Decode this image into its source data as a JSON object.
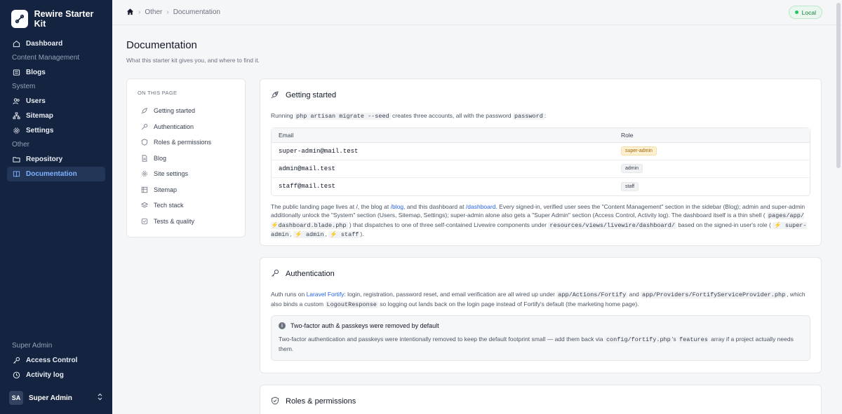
{
  "app": {
    "name": "Rewire Starter Kit"
  },
  "sidebar": {
    "items": [
      {
        "type": "item",
        "label": "Dashboard",
        "icon": "home-icon",
        "active": false
      },
      {
        "type": "section",
        "label": "Content Management"
      },
      {
        "type": "item",
        "label": "Blogs",
        "icon": "list-icon",
        "active": false
      },
      {
        "type": "section",
        "label": "System"
      },
      {
        "type": "item",
        "label": "Users",
        "icon": "users-icon",
        "active": false
      },
      {
        "type": "item",
        "label": "Sitemap",
        "icon": "sitemap-icon",
        "active": false
      },
      {
        "type": "item",
        "label": "Settings",
        "icon": "gear-icon",
        "active": false
      },
      {
        "type": "section",
        "label": "Other"
      },
      {
        "type": "item",
        "label": "Repository",
        "icon": "folder-icon",
        "active": false
      },
      {
        "type": "item",
        "label": "Documentation",
        "icon": "book-icon",
        "active": true
      }
    ],
    "bottom": [
      {
        "type": "section",
        "label": "Super Admin"
      },
      {
        "type": "item",
        "label": "Access Control",
        "icon": "key-icon"
      },
      {
        "type": "item",
        "label": "Activity log",
        "icon": "clock-icon"
      }
    ],
    "user": {
      "initials": "SA",
      "name": "Super Admin"
    }
  },
  "breadcrumb": {
    "items": [
      "Other",
      "Documentation"
    ]
  },
  "env_badge": "Local",
  "page": {
    "title": "Documentation",
    "subtitle": "What this starter kit gives you, and where to find it."
  },
  "toc": {
    "title": "ON THIS PAGE",
    "items": [
      "Getting started",
      "Authentication",
      "Roles & permissions",
      "Blog",
      "Site settings",
      "Sitemap",
      "Tech stack",
      "Tests & quality"
    ]
  },
  "getting_started": {
    "title": "Getting started",
    "intro_1": "Running",
    "intro_code": "php artisan migrate --seed",
    "intro_2": "creates three accounts, all with the password",
    "intro_password": "password",
    "intro_3": ":",
    "table": {
      "headers": [
        "Email",
        "Role"
      ],
      "rows": [
        {
          "email": "super-admin@mail.test",
          "role": "super-admin"
        },
        {
          "email": "admin@mail.test",
          "role": "admin"
        },
        {
          "email": "staff@mail.test",
          "role": "staff"
        }
      ]
    },
    "p1": "The public landing page lives at /, the blog at",
    "link_blog": "/blog",
    "p2": ", and this dashboard at",
    "link_dashboard": "/dashboard",
    "p3": ". Every signed-in, verified user sees the \"Content Management\" section in the sidebar (Blog); admin and super-admin additionally unlock the \"System\" section (Users, Sitemap, Settings); super-admin alone also gets a \"Super Admin\" section (Access Control, Activity log). The dashboard itself is a thin shell (",
    "code_pages_pre": "pages/app/",
    "code_pages_post": "dashboard.blade.php",
    "p4": ") that dispatches to one of three self-contained Livewire components under",
    "code_views": "resources/views/livewire/dashboard/",
    "p5": "based on the signed-in user's role (",
    "role_codes": [
      "super-admin",
      "admin",
      "staff"
    ],
    "p6": ")."
  },
  "authentication": {
    "title": "Authentication",
    "a1": "Auth runs on",
    "link_fortify": "Laravel Fortify",
    "a2": ": login, registration, password reset, and email verification are all wired up under",
    "code_actions": "app/Actions/Fortify",
    "a3": "and",
    "code_provider": "app/Providers/FortifyServiceProvider.php",
    "a4": ", which also binds a custom",
    "code_logout": "LogoutResponse",
    "a5": "so logging out lands back on the login page instead of Fortify's default (the marketing home page).",
    "callout_title": "Two-factor auth & passkeys were removed by default",
    "c1": "Two-factor authentication and passkeys were intentionally removed to keep the default footprint small — add them back via",
    "code_config": "config/fortify.php",
    "c2": "'s",
    "code_features": "features",
    "c3": "array if a project actually needs them."
  },
  "roles": {
    "title": "Roles & permissions"
  }
}
